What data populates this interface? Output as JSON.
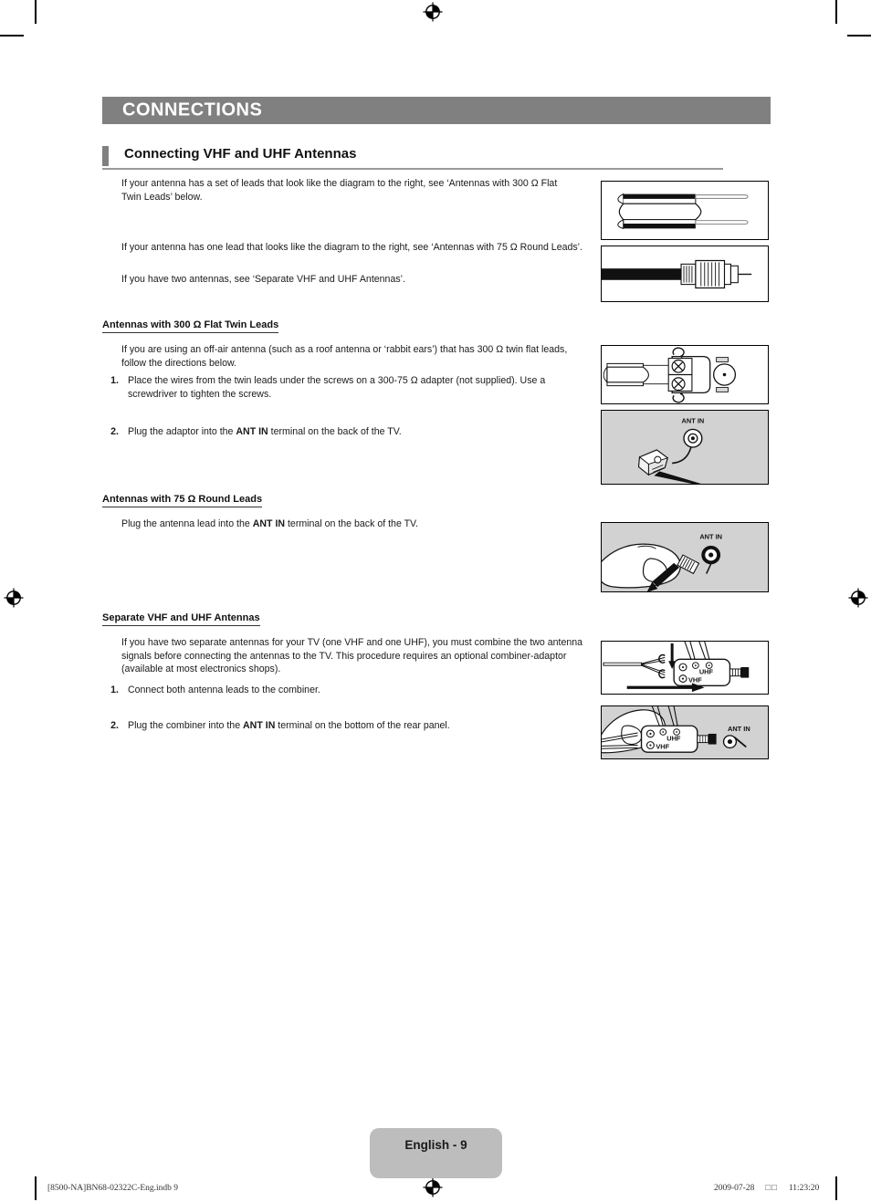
{
  "chapter": {
    "title": "CONNECTIONS"
  },
  "section": {
    "title": "Connecting VHF and UHF Antennas"
  },
  "intro": {
    "p1": "If your antenna has a set of leads that look like the diagram to the right, see ‘Antennas with 300 Ω Flat Twin Leads’ below.",
    "p2": "If your antenna has one lead that looks like the diagram to the right, see ‘Antennas with 75 Ω Round Leads’.",
    "p3": "If you have two antennas, see ‘Separate VHF and UHF Antennas’."
  },
  "flat_twin": {
    "heading": "Antennas with 300 Ω Flat Twin Leads",
    "body": "If you are using an off-air antenna (such as a roof antenna or ‘rabbit ears’) that has 300 Ω twin flat leads, follow the directions below.",
    "step1_num": "1.",
    "step1_text": "Place the wires from the twin leads under the screws on a 300-75 Ω adapter (not supplied). Use a screwdriver to tighten the screws.",
    "step2_num": "2.",
    "step2_prefix": "Plug the adaptor into the ",
    "step2_bold": "ANT IN",
    "step2_suffix": " terminal on the back of the TV."
  },
  "round_leads": {
    "heading": "Antennas with 75 Ω Round Leads",
    "body_prefix": "Plug the antenna lead into the ",
    "body_bold": "ANT IN",
    "body_suffix": " terminal on the back of the TV."
  },
  "separate": {
    "heading": "Separate VHF and UHF Antennas",
    "body": "If you have two separate antennas for your TV (one VHF and one UHF), you must combine the two antenna signals before connecting the antennas to the TV. This procedure requires an optional combiner-adaptor (available at most electronics shops).",
    "step1_num": "1.",
    "step1_text": "Connect both antenna leads to the combiner.",
    "step2_num": "2.",
    "step2_prefix": "Plug the combiner into the ",
    "step2_bold": "ANT IN",
    "step2_suffix": " terminal on the bottom of the rear panel."
  },
  "figures": {
    "flat_twin_lead_cable": "flat-twin-lead-cable-diagram",
    "round_lead_cable": "round-coax-lead-connector-diagram",
    "adapter_screws": "300-75-ohm-adapter-screws-diagram",
    "adapter_into_ant_in": "adapter-plugged-into-ant-in-diagram",
    "round_into_ant_in": "round-lead-plugged-into-ant-in-diagram",
    "combiner_leads": "combiner-connect-leads-diagram",
    "combiner_into_ant_in": "combiner-plugged-into-ant-in-diagram",
    "ant_in_label": "ANT IN",
    "uhf_label": "UHF",
    "vhf_label": "VHF"
  },
  "footer": {
    "page_label": "English - 9",
    "file_name": "[8500-NA]BN68-02322C-Eng.indb   9",
    "date": "2009-07-28",
    "tofu": "□□",
    "time": "11:23:20"
  },
  "colors": {
    "chapter_bar": "#808080",
    "section_tick": "#808080",
    "shaded_figure": "#d2d2d2",
    "page_badge": "#bdbdbd",
    "text": "#1a1a1a"
  }
}
